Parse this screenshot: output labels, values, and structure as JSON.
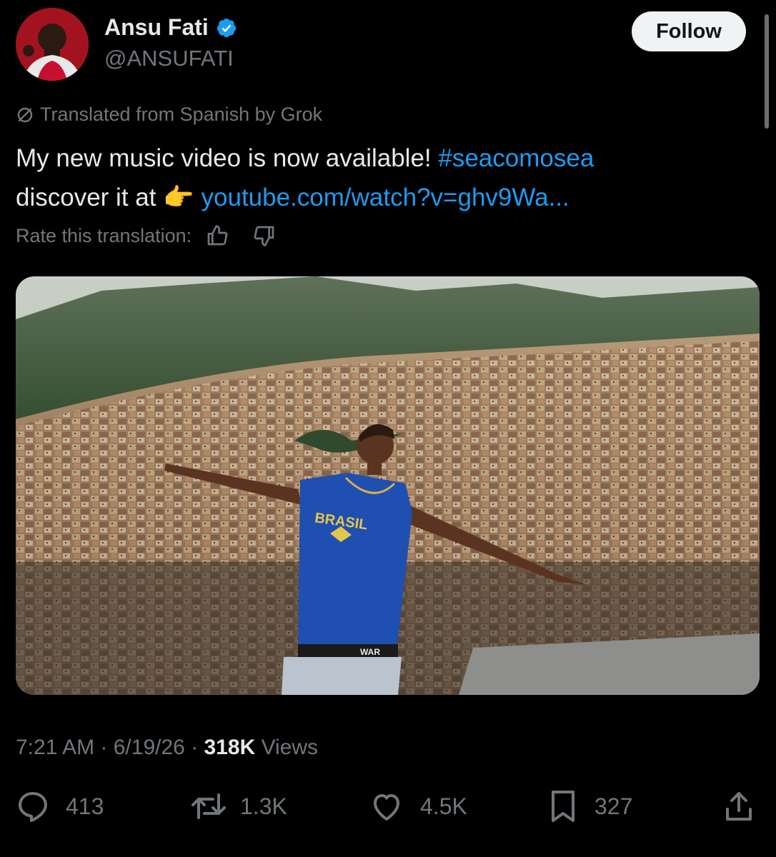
{
  "author": {
    "name": "Ansu Fati",
    "handle": "@ANSUFATI",
    "verified": true,
    "avatar_icon": "profile-photo"
  },
  "follow_label": "Follow",
  "translation_note": "Translated from Spanish by Grok",
  "tweet": {
    "text_1": "My new music video is now available!",
    "hashtag": "#seacomosea",
    "text_2": "discover it at",
    "emoji": "👉",
    "link": "youtube.com/watch?v=ghv9Wa..."
  },
  "rate_label": "Rate this translation:",
  "media": {
    "shirt_text": "BRASIL",
    "belt_text": "WAR"
  },
  "meta": {
    "time": "7:21 AM",
    "date": "6/19/26",
    "views_count": "318K",
    "views_label": "Views"
  },
  "actions": {
    "replies": "413",
    "reposts": "1.3K",
    "likes": "4.5K",
    "bookmarks": "327"
  },
  "colors": {
    "accent": "#1d9bf0",
    "muted": "#71767b",
    "text": "#e7e9ea"
  }
}
